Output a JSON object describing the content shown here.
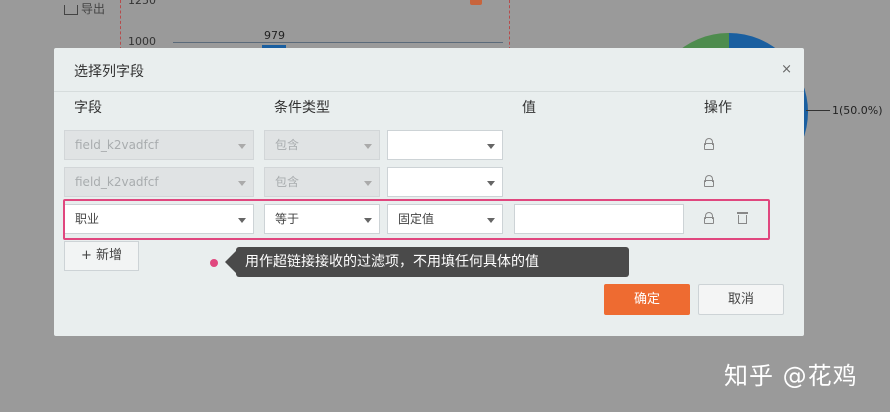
{
  "background": {
    "export_label": "导出",
    "tick_1250": "1250",
    "tick_1000": "1000",
    "bar_label": "979",
    "pie_label": "1(50.0%)"
  },
  "dialog": {
    "title": "选择列字段",
    "close_glyph": "×",
    "columns": [
      "字段",
      "条件类型",
      "值",
      "操作"
    ],
    "rows": [
      {
        "field": "field_k2vadfcf",
        "condition": "包含",
        "value_type": "",
        "disabled": true
      },
      {
        "field": "field_k2vadfcf",
        "condition": "包含",
        "value_type": "",
        "disabled": true
      },
      {
        "field": "职业",
        "condition": "等于",
        "value_type": "固定值",
        "value": "",
        "disabled": false
      }
    ],
    "add_label": "+ 新增",
    "ok_label": "确定",
    "cancel_label": "取消"
  },
  "tooltip": {
    "text": "用作超链接接收的过滤项，不用填任何具体的值"
  },
  "watermark": "知乎 @花鸡",
  "colors": {
    "accent": "#ee6b31",
    "highlight": "#e0477e",
    "pie_blue": "#1a5fa0",
    "pie_green": "#4e8c4e"
  }
}
